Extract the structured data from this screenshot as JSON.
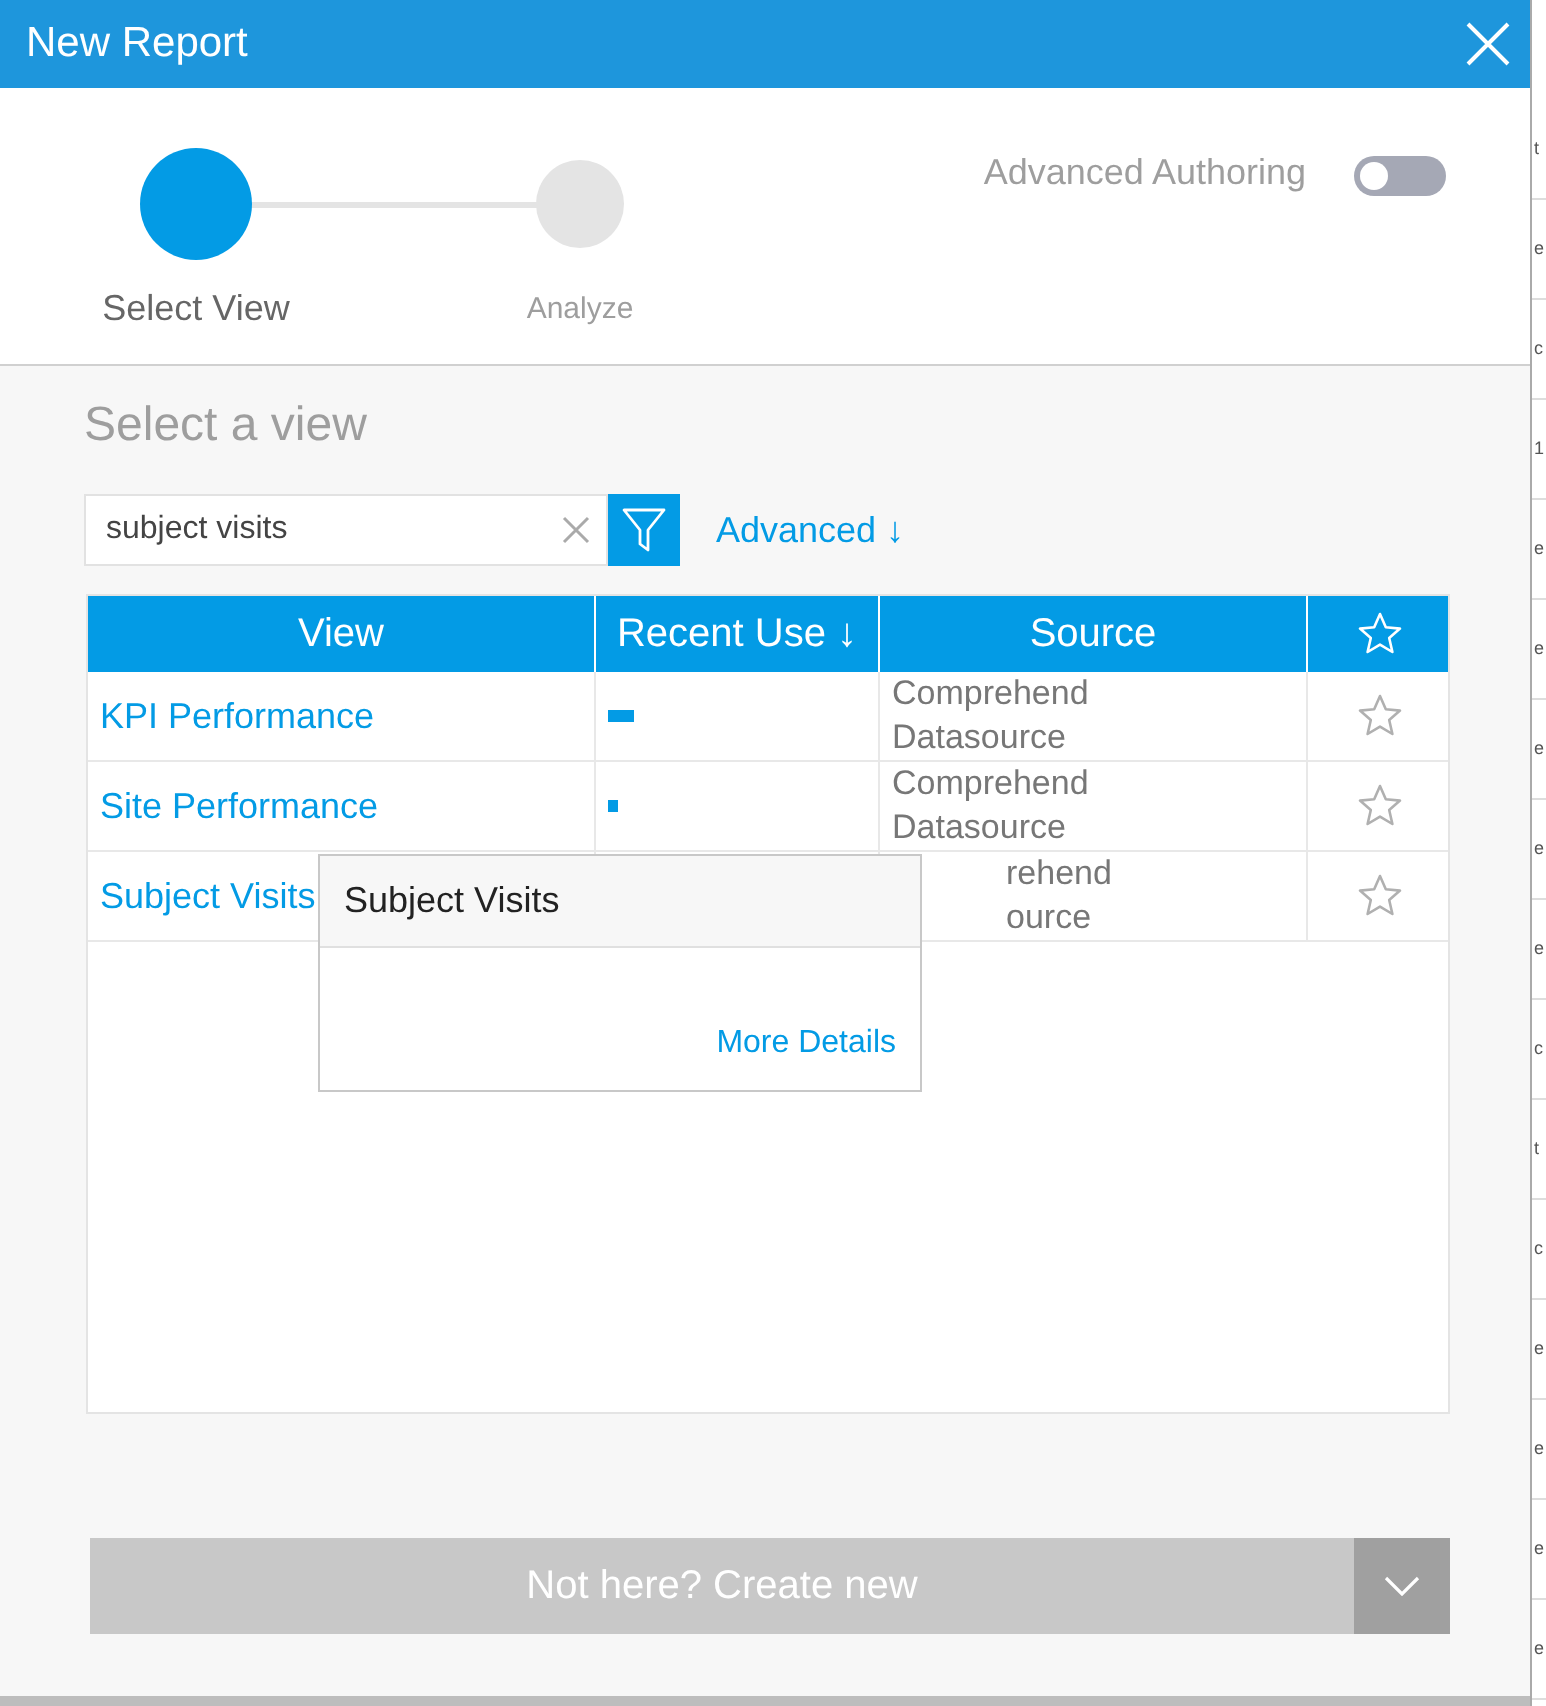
{
  "window": {
    "title": "New Report"
  },
  "steps": [
    {
      "label": "Select View",
      "selected": true
    },
    {
      "label": "Analyze",
      "selected": false
    }
  ],
  "advanced_authoring": {
    "label": "Advanced Authoring",
    "on": false
  },
  "heading": "Select a view",
  "search": {
    "value": "subject visits"
  },
  "advanced_link": "Advanced ↓",
  "table": {
    "columns": [
      "View",
      "Recent Use ↓",
      "Source"
    ],
    "rows": [
      {
        "view": "KPI Performance",
        "recent_use": {
          "level": 0.1
        },
        "source": "Comprehend Datasource",
        "favorite": false
      },
      {
        "view": "Site Performance",
        "recent_use": {
          "level": 0.04
        },
        "source": "Comprehend Datasource",
        "favorite": false
      },
      {
        "view": "Subject Visits",
        "source": "rehend ource",
        "source_covered": true,
        "favorite": false
      }
    ]
  },
  "tooltip": {
    "title": "Subject Visits",
    "link": "More Details"
  },
  "create_button": "Not here? Create new",
  "background_letters": [
    "t",
    "e",
    "c",
    "1",
    "e",
    "e",
    "e",
    "e",
    "e",
    "c",
    "t",
    "c",
    "e",
    "e",
    "e",
    "e"
  ]
}
